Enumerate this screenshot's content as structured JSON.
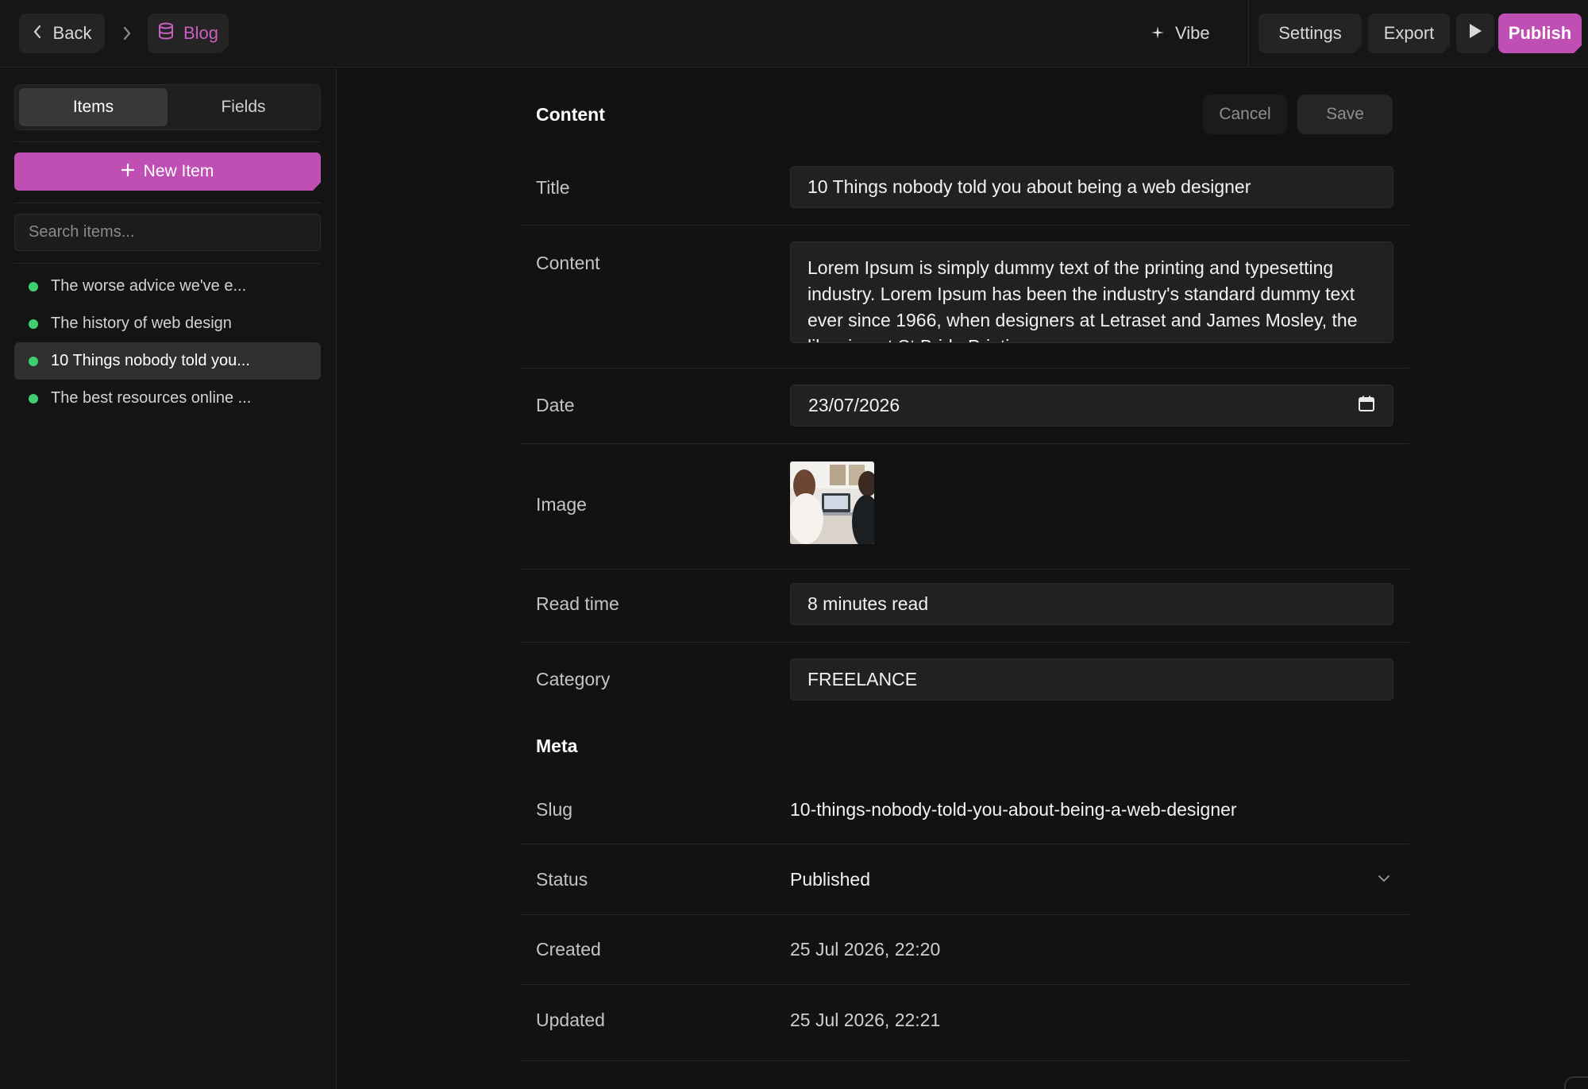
{
  "topbar": {
    "back_label": "Back",
    "collection_label": "Blog",
    "vibe_label": "Vibe",
    "settings_label": "Settings",
    "export_label": "Export",
    "publish_label": "Publish"
  },
  "sidebar": {
    "tabs": [
      {
        "label": "Items",
        "active": true
      },
      {
        "label": "Fields",
        "active": false
      }
    ],
    "new_item_label": "New Item",
    "search_placeholder": "Search items...",
    "items": [
      {
        "label": "The worse advice we've e...",
        "status": "published",
        "selected": false
      },
      {
        "label": "The history of web design",
        "status": "published",
        "selected": false
      },
      {
        "label": "10 Things nobody told you...",
        "status": "published",
        "selected": true
      },
      {
        "label": "The best resources online ...",
        "status": "published",
        "selected": false
      }
    ]
  },
  "content": {
    "section_title": "Content",
    "cancel_label": "Cancel",
    "save_label": "Save",
    "fields": {
      "title": {
        "label": "Title",
        "value": "10 Things nobody told you about being a web designer"
      },
      "content": {
        "label": "Content",
        "value": "Lorem Ipsum is simply dummy text of the printing and typesetting industry. Lorem Ipsum has been the industry's standard dummy text ever since 1966, when designers at Letraset and James Mosley, the librarian at St Bride Printing"
      },
      "date": {
        "label": "Date",
        "value": "23/07/2026"
      },
      "image": {
        "label": "Image"
      },
      "read_time": {
        "label": "Read time",
        "value": "8 minutes read"
      },
      "category": {
        "label": "Category",
        "value": "FREELANCE"
      }
    }
  },
  "meta": {
    "section_title": "Meta",
    "slug": {
      "label": "Slug",
      "value": "10-things-nobody-told-you-about-being-a-web-designer"
    },
    "status": {
      "label": "Status",
      "value": "Published"
    },
    "created": {
      "label": "Created",
      "value": "25 Jul 2026, 22:20"
    },
    "updated": {
      "label": "Updated",
      "value": "25 Jul 2026, 22:21"
    }
  },
  "colors": {
    "accent": "#c04fb4",
    "status_published": "#3ecf70",
    "background": "#121212"
  }
}
